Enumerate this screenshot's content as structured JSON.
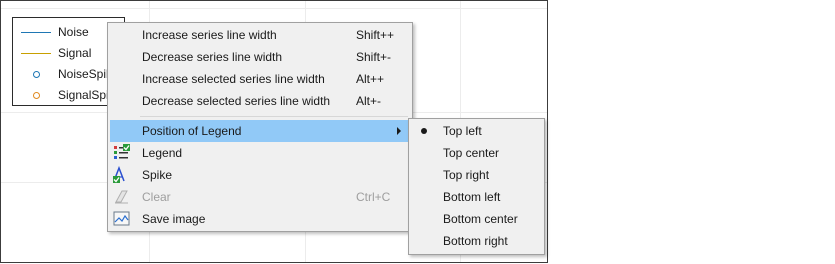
{
  "legend": {
    "items": [
      {
        "label": "Noise",
        "kind": "line",
        "color": "#1f77b4"
      },
      {
        "label": "Signal",
        "kind": "line",
        "color": "#c8a000"
      },
      {
        "label": "NoiseSpikes",
        "kind": "marker",
        "color": "#1f77b4"
      },
      {
        "label": "SignalSpikes",
        "kind": "marker",
        "color": "#e08a20"
      }
    ]
  },
  "context_menu": {
    "items": [
      {
        "label": "Increase series line width",
        "shortcut": "Shift++"
      },
      {
        "label": "Decrease series line width",
        "shortcut": "Shift+-"
      },
      {
        "label": "Increase selected series line width",
        "shortcut": "Alt++"
      },
      {
        "label": "Decrease selected series line width",
        "shortcut": "Alt+-"
      },
      {
        "label": "Position of Legend",
        "has_submenu": true,
        "highlighted": true
      },
      {
        "label": "Legend",
        "icon": "legend-icon"
      },
      {
        "label": "Spike",
        "icon": "spike-icon"
      },
      {
        "label": "Clear",
        "shortcut": "Ctrl+C",
        "icon": "clear-icon",
        "disabled": true
      },
      {
        "label": "Save image",
        "icon": "save-image-icon"
      }
    ]
  },
  "legend_position_submenu": {
    "items": [
      {
        "label": "Top left",
        "selected": true
      },
      {
        "label": "Top center"
      },
      {
        "label": "Top right"
      },
      {
        "label": "Bottom left"
      },
      {
        "label": "Bottom center"
      },
      {
        "label": "Bottom right"
      }
    ]
  },
  "colors": {
    "highlight": "#91c9f7",
    "menu_background": "#f0f0f0",
    "disabled_text": "#9e9e9e"
  }
}
